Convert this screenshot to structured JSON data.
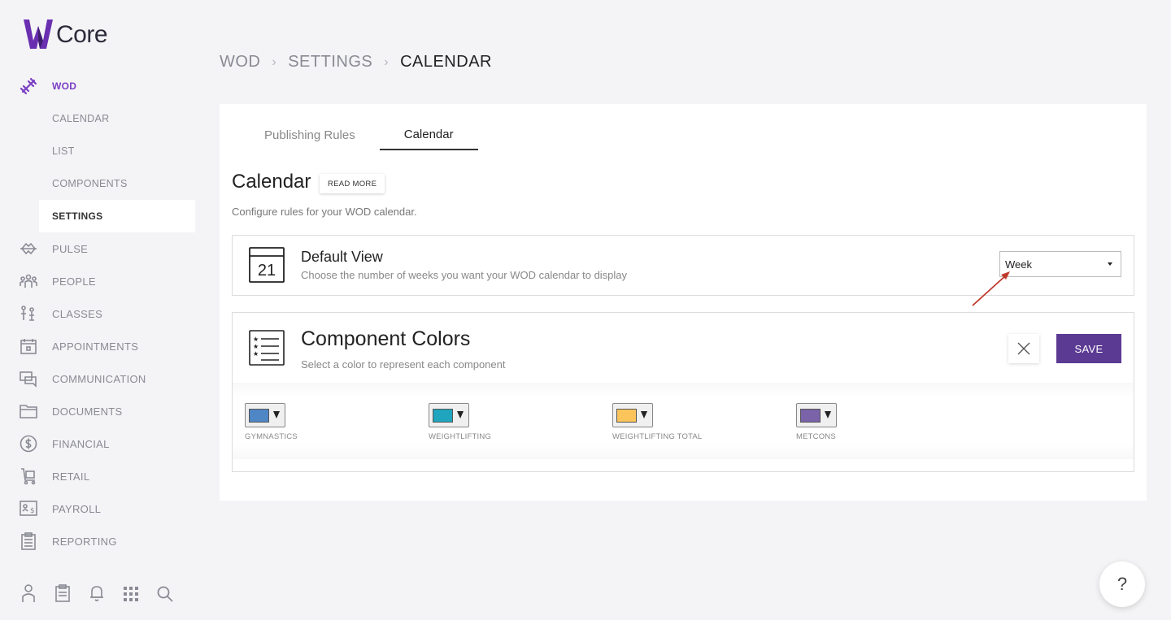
{
  "app": {
    "logo_text": "Core"
  },
  "sidebar": {
    "items": [
      {
        "label": "WOD",
        "icon": "dumbbell-icon",
        "active": true
      },
      {
        "label": "PULSE",
        "icon": "pulse-icon"
      },
      {
        "label": "PEOPLE",
        "icon": "people-icon"
      },
      {
        "label": "CLASSES",
        "icon": "classes-icon"
      },
      {
        "label": "APPOINTMENTS",
        "icon": "appointments-icon"
      },
      {
        "label": "COMMUNICATION",
        "icon": "communication-icon"
      },
      {
        "label": "DOCUMENTS",
        "icon": "folder-icon"
      },
      {
        "label": "FINANCIAL",
        "icon": "dollar-icon"
      },
      {
        "label": "RETAIL",
        "icon": "cart-icon"
      },
      {
        "label": "PAYROLL",
        "icon": "payroll-icon"
      },
      {
        "label": "REPORTING",
        "icon": "report-icon"
      }
    ],
    "subitems": [
      {
        "label": "CALENDAR"
      },
      {
        "label": "LIST"
      },
      {
        "label": "COMPONENTS"
      },
      {
        "label": "SETTINGS",
        "selected": true
      }
    ],
    "bottom_icons": [
      "user-icon",
      "clipboard-icon",
      "bell-icon",
      "apps-grid-icon",
      "search-icon"
    ]
  },
  "breadcrumb": {
    "items": [
      "WOD",
      "SETTINGS",
      "CALENDAR"
    ]
  },
  "tabs": [
    {
      "label": "Publishing Rules"
    },
    {
      "label": "Calendar",
      "active": true
    }
  ],
  "section": {
    "title": "Calendar",
    "read_more": "READ MORE",
    "description": "Configure rules for your WOD calendar."
  },
  "default_view": {
    "icon_day": "21",
    "title": "Default View",
    "subtitle": "Choose the number of weeks you want your WOD calendar to display",
    "selected": "Week"
  },
  "component_colors": {
    "title": "Component Colors",
    "subtitle": "Select a color to represent each component",
    "save_label": "SAVE",
    "items": [
      {
        "label": "GYMNASTICS",
        "color": "#4f86c6"
      },
      {
        "label": "WEIGHTLIFTING",
        "color": "#1fa5be"
      },
      {
        "label": "WEIGHTLIFTING TOTAL",
        "color": "#fbc55c"
      },
      {
        "label": "METCONS",
        "color": "#7a63a8"
      }
    ]
  },
  "help": {
    "label": "?"
  },
  "colors": {
    "accent": "#7a3fc4",
    "save_bg": "#5b3a93",
    "annotation": "#c0392b"
  }
}
